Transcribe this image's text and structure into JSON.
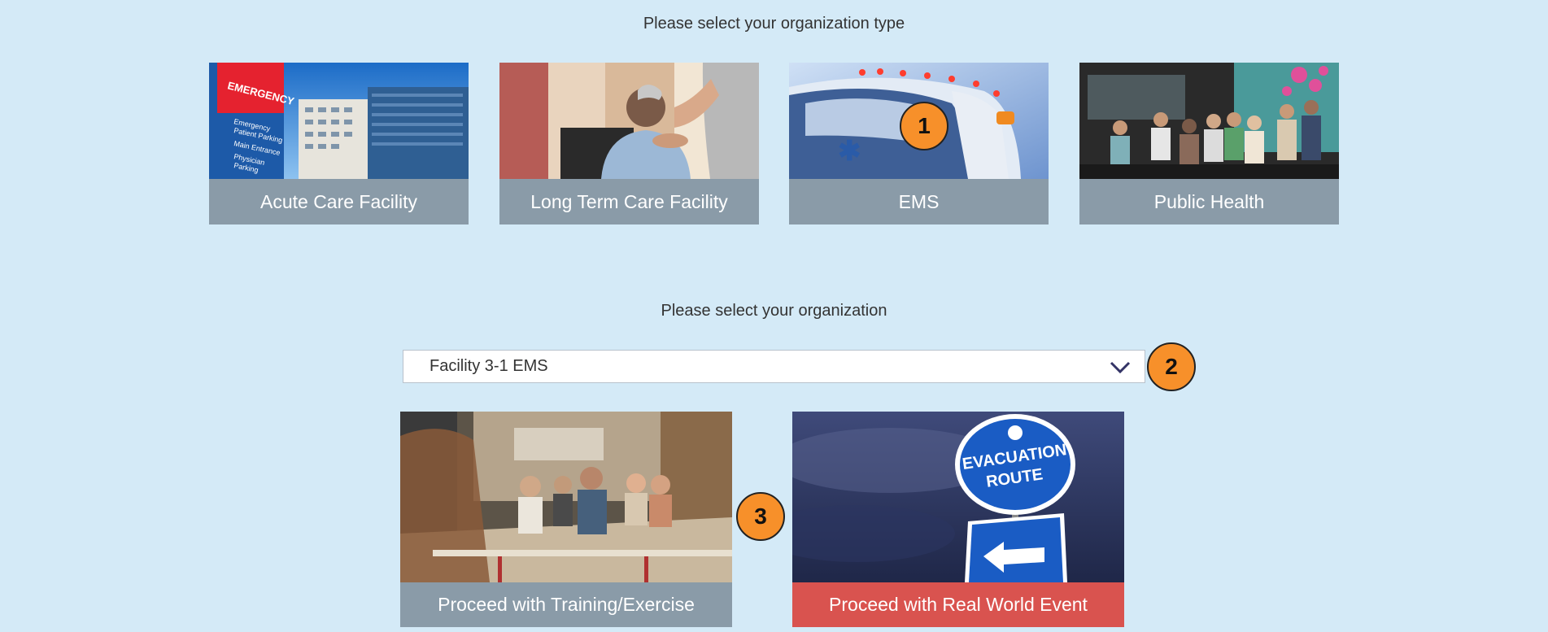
{
  "org_type_heading": "Please select your organization type",
  "org_types": [
    {
      "label": "Acute Care Facility",
      "icon": "hospital-image"
    },
    {
      "label": "Long Term Care Facility",
      "icon": "caregiver-image"
    },
    {
      "label": "EMS",
      "icon": "ambulance-image"
    },
    {
      "label": "Public Health",
      "icon": "meeting-image"
    }
  ],
  "hospital_sign": {
    "emergency": "EMERGENCY",
    "lines": [
      "Emergency",
      "Patient Parking",
      "Main Entrance",
      "Physician",
      "Parking"
    ]
  },
  "organization_heading": "Please select your organization",
  "organization_select": {
    "value": "Facility 3-1 EMS"
  },
  "callouts": [
    "1",
    "2",
    "3"
  ],
  "actions": [
    {
      "label": "Proceed with Training/Exercise",
      "icon": "classroom-image"
    },
    {
      "label": "Proceed with Real World Event",
      "icon": "evacuation-sign-image"
    }
  ],
  "evacuation_sign": {
    "line1": "EVACUATION",
    "line2": "ROUTE"
  },
  "colors": {
    "background": "#d4eaf7",
    "card_label": "#8a9ba8",
    "real_world_label": "#d9534f",
    "callout": "#f7902a"
  }
}
